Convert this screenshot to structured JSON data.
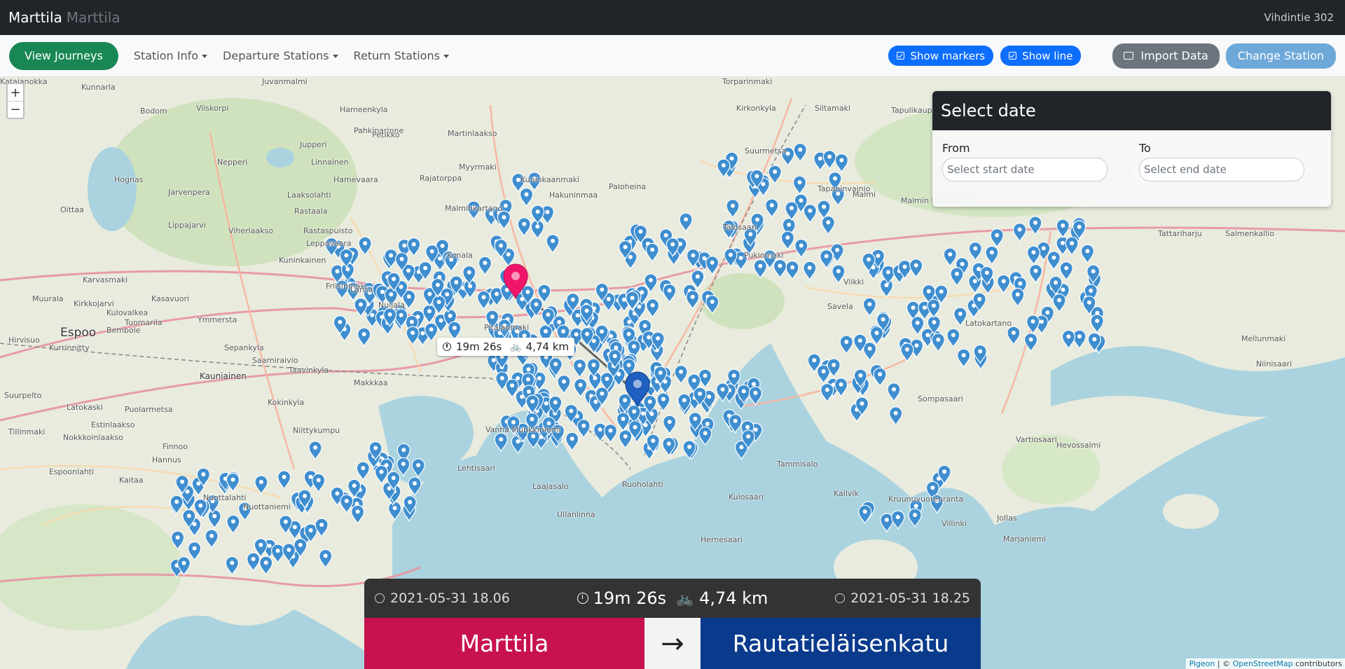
{
  "header": {
    "brand": "Marttila",
    "brand_sub": "Marttila",
    "address": "Vihdintie 302"
  },
  "nav": {
    "view_journeys": "View Journeys",
    "station_info": "Station Info",
    "departure_stations": "Departure Stations",
    "return_stations": "Return Stations",
    "show_markers": "Show markers",
    "show_line": "Show line",
    "import_data": "Import Data",
    "change_station": "Change Station"
  },
  "map": {
    "zoom_in": "+",
    "zoom_out": "−",
    "tooltip": {
      "duration": "19m 26s",
      "distance": "4,74 km"
    },
    "places": [
      {
        "name": "Espoo",
        "cls": "big"
      },
      {
        "name": "Kauniainen",
        "cls": "mid"
      },
      {
        "name": "Juvanmalmi"
      },
      {
        "name": "Kunnarla"
      },
      {
        "name": "Bodom"
      },
      {
        "name": "Viiskorpi"
      },
      {
        "name": "Hameenkyla"
      },
      {
        "name": "Pahkinarinne"
      },
      {
        "name": "Jupperi"
      },
      {
        "name": "Linnainen"
      },
      {
        "name": "Nepperi"
      },
      {
        "name": "Hognas"
      },
      {
        "name": "Jarvenpera"
      },
      {
        "name": "Hamevaara"
      },
      {
        "name": "Laaksolahti"
      },
      {
        "name": "Oittaa"
      },
      {
        "name": "Lippajarvi"
      },
      {
        "name": "Rastaala"
      },
      {
        "name": "Rastaspuisto"
      },
      {
        "name": "Viherlaakso"
      },
      {
        "name": "Leppavaara"
      },
      {
        "name": "Kuninkainen"
      },
      {
        "name": "Karvasmaki"
      },
      {
        "name": "Friisinmaki"
      },
      {
        "name": "Lansa"
      },
      {
        "name": "Muurala"
      },
      {
        "name": "Kirkkojarvi"
      },
      {
        "name": "Kasavuori"
      },
      {
        "name": "Nuijala"
      },
      {
        "name": "Kulovalkea"
      },
      {
        "name": "Tuomarila"
      },
      {
        "name": "Ymmersta"
      },
      {
        "name": "Sepankyla"
      },
      {
        "name": "Kurrinnitty"
      },
      {
        "name": "Saarniraivio"
      },
      {
        "name": "Taavinkyla"
      },
      {
        "name": "Makkkaa"
      },
      {
        "name": "Suurpelto"
      },
      {
        "name": "Latokaski"
      },
      {
        "name": "Puolarmetsa"
      },
      {
        "name": "Kokinkyla"
      },
      {
        "name": "Estinlaakso"
      },
      {
        "name": "Nokkkoinlaakso"
      },
      {
        "name": "Niittykumpu"
      },
      {
        "name": "Finnoo"
      },
      {
        "name": "Hannus"
      },
      {
        "name": "Espoonlahti"
      },
      {
        "name": "Kaitaa"
      },
      {
        "name": "Nuottalahti"
      },
      {
        "name": "Nuottaniemi"
      },
      {
        "name": "Tillinmaki"
      },
      {
        "name": "Hirvisuo"
      },
      {
        "name": "Bembole"
      },
      {
        "name": "Lehtisaari"
      },
      {
        "name": "Vanha Munkkiniemi"
      },
      {
        "name": "Pitajanmaki"
      },
      {
        "name": "Konala"
      },
      {
        "name": "Malminkartano"
      },
      {
        "name": "Myyrmaki"
      },
      {
        "name": "Rajatorppa"
      },
      {
        "name": "Petikko"
      },
      {
        "name": "Martinlaakso"
      },
      {
        "name": "Kuninkaanmaki"
      },
      {
        "name": "Hakuninmaa"
      },
      {
        "name": "Paloheina"
      },
      {
        "name": "Torparinmaki"
      },
      {
        "name": "Kirkonkyla"
      },
      {
        "name": "Siltamaki"
      },
      {
        "name": "Tapulikaupunki"
      },
      {
        "name": "Puistola"
      },
      {
        "name": "Suurmetsa"
      },
      {
        "name": "Tapaninvainio"
      },
      {
        "name": "Malmi"
      },
      {
        "name": "Malmin lentokentta"
      },
      {
        "name": "Tattariharju"
      },
      {
        "name": "Salmenkallio"
      },
      {
        "name": "Talosaari"
      },
      {
        "name": "Pukinmaki"
      },
      {
        "name": "Savela"
      },
      {
        "name": "Viikki"
      },
      {
        "name": "Latokartano"
      },
      {
        "name": "Mellunmaki"
      },
      {
        "name": "Niinisaari"
      },
      {
        "name": "Kallvik"
      },
      {
        "name": "Kruunuvuorenranta"
      },
      {
        "name": "Hevossalmi"
      },
      {
        "name": "Vartiosaari"
      },
      {
        "name": "Tammisalo"
      },
      {
        "name": "Kulosaari"
      },
      {
        "name": "Sompasaari"
      },
      {
        "name": "Marjaniemi"
      },
      {
        "name": "Villinki"
      },
      {
        "name": "Jollas"
      },
      {
        "name": "Laajasalo"
      },
      {
        "name": "Ruoholahti"
      },
      {
        "name": "Ullanlinna"
      },
      {
        "name": "Hernesaari"
      },
      {
        "name": "Katajanokka"
      }
    ]
  },
  "date_panel": {
    "title": "Select date",
    "from_label": "From",
    "from_placeholder": "Select start date",
    "to_label": "To",
    "to_placeholder": "Select end date"
  },
  "journey": {
    "departure_time": "2021-05-31 18.06",
    "duration": "19m 26s",
    "distance": "4,74 km",
    "return_time": "2021-05-31 18.25",
    "from_station": "Marttila",
    "to_station": "Rautatieläisenkatu",
    "arrow": "→"
  },
  "attribution": {
    "leaflet": "Pigeon",
    "sep": " | © ",
    "osm": "OpenStreetMap",
    "suffix": " contributors"
  },
  "colors": {
    "from": "#c8124e",
    "to": "#0a3a8c",
    "marker": "#3f8ecf",
    "accent_green": "#198754"
  }
}
